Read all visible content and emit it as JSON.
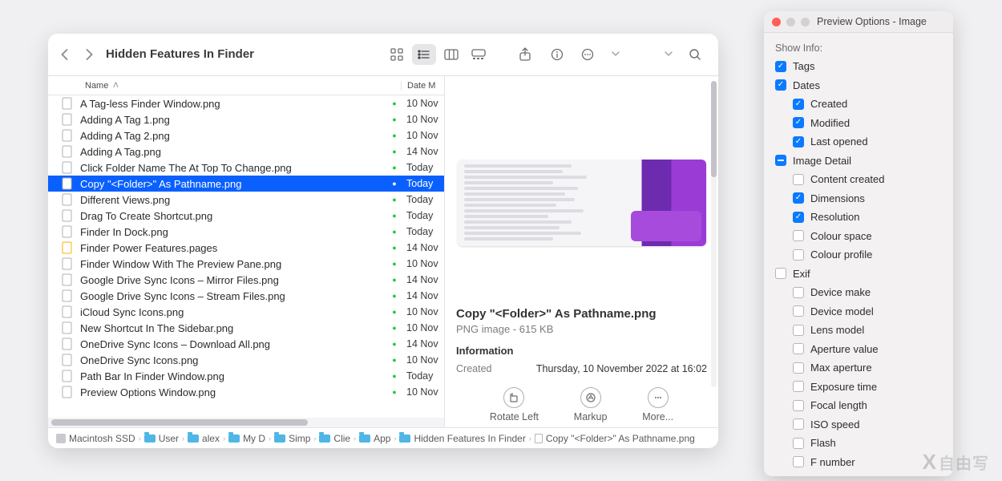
{
  "finder": {
    "title": "Hidden Features In Finder",
    "columns": {
      "name": "Name",
      "date": "Date M"
    },
    "files": [
      {
        "name": "A Tag-less Finder Window.png",
        "date": "10 Nov",
        "sync": true
      },
      {
        "name": "Adding A Tag 1.png",
        "date": "10 Nov",
        "sync": true
      },
      {
        "name": "Adding A Tag 2.png",
        "date": "10 Nov",
        "sync": true
      },
      {
        "name": "Adding A Tag.png",
        "date": "14 Nov",
        "sync": true
      },
      {
        "name": "Click Folder Name The At Top To Change.png",
        "date": "Today",
        "sync": true
      },
      {
        "name": "Copy \"<Folder>\" As Pathname.png",
        "date": "Today",
        "sync": true,
        "selected": true
      },
      {
        "name": "Different Views.png",
        "date": "Today",
        "sync": true
      },
      {
        "name": "Drag To Create Shortcut.png",
        "date": "Today",
        "sync": true
      },
      {
        "name": "Finder In Dock.png",
        "date": "Today",
        "sync": true
      },
      {
        "name": "Finder Power Features.pages",
        "date": "14 Nov",
        "sync": true,
        "kind": "pages"
      },
      {
        "name": "Finder Window With The Preview Pane.png",
        "date": "10 Nov",
        "sync": true
      },
      {
        "name": "Google Drive Sync Icons – Mirror Files.png",
        "date": "14 Nov",
        "sync": true
      },
      {
        "name": "Google Drive Sync Icons – Stream Files.png",
        "date": "14 Nov",
        "sync": true
      },
      {
        "name": "iCloud Sync Icons.png",
        "date": "10 Nov",
        "sync": true
      },
      {
        "name": "New Shortcut In The Sidebar.png",
        "date": "10 Nov",
        "sync": true
      },
      {
        "name": "OneDrive Sync Icons – Download All.png",
        "date": "14 Nov",
        "sync": true
      },
      {
        "name": "OneDrive Sync Icons.png",
        "date": "10 Nov",
        "sync": true
      },
      {
        "name": "Path Bar In Finder Window.png",
        "date": "Today",
        "sync": true
      },
      {
        "name": "Preview Options Window.png",
        "date": "10 Nov",
        "sync": true
      }
    ],
    "preview": {
      "title": "Copy \"<Folder>\" As Pathname.png",
      "subtitle": "PNG image - 615 KB",
      "info_header": "Information",
      "created_label": "Created",
      "created_value": "Thursday, 10 November 2022 at 16:02",
      "actions": {
        "rotate": "Rotate Left",
        "markup": "Markup",
        "more": "More..."
      }
    },
    "path": [
      {
        "label": "Macintosh SSD",
        "kind": "disk"
      },
      {
        "label": "User",
        "kind": "folder"
      },
      {
        "label": "alex",
        "kind": "folder"
      },
      {
        "label": "My D",
        "kind": "folder"
      },
      {
        "label": "Simp",
        "kind": "folder"
      },
      {
        "label": "Clie",
        "kind": "folder"
      },
      {
        "label": "App",
        "kind": "folder"
      },
      {
        "label": "Hidden Features In Finder",
        "kind": "folder"
      },
      {
        "label": "Copy \"<Folder>\" As Pathname.png",
        "kind": "file"
      }
    ]
  },
  "prefs": {
    "title": "Preview Options - Image",
    "show_info": "Show Info:",
    "options": [
      {
        "label": "Tags",
        "state": "on",
        "indent": 0
      },
      {
        "label": "Dates",
        "state": "on",
        "indent": 0
      },
      {
        "label": "Created",
        "state": "on",
        "indent": 1
      },
      {
        "label": "Modified",
        "state": "on",
        "indent": 1
      },
      {
        "label": "Last opened",
        "state": "on",
        "indent": 1
      },
      {
        "label": "Image Detail",
        "state": "mixed",
        "indent": 0
      },
      {
        "label": "Content created",
        "state": "off",
        "indent": 1
      },
      {
        "label": "Dimensions",
        "state": "on",
        "indent": 1
      },
      {
        "label": "Resolution",
        "state": "on",
        "indent": 1
      },
      {
        "label": "Colour space",
        "state": "off",
        "indent": 1
      },
      {
        "label": "Colour profile",
        "state": "off",
        "indent": 1
      },
      {
        "label": "Exif",
        "state": "off",
        "indent": 0
      },
      {
        "label": "Device make",
        "state": "off",
        "indent": 1
      },
      {
        "label": "Device model",
        "state": "off",
        "indent": 1
      },
      {
        "label": "Lens model",
        "state": "off",
        "indent": 1
      },
      {
        "label": "Aperture value",
        "state": "off",
        "indent": 1
      },
      {
        "label": "Max aperture",
        "state": "off",
        "indent": 1
      },
      {
        "label": "Exposure time",
        "state": "off",
        "indent": 1
      },
      {
        "label": "Focal length",
        "state": "off",
        "indent": 1
      },
      {
        "label": "ISO speed",
        "state": "off",
        "indent": 1
      },
      {
        "label": "Flash",
        "state": "off",
        "indent": 1
      },
      {
        "label": "F number",
        "state": "off",
        "indent": 1
      }
    ]
  },
  "watermark": "自由写"
}
